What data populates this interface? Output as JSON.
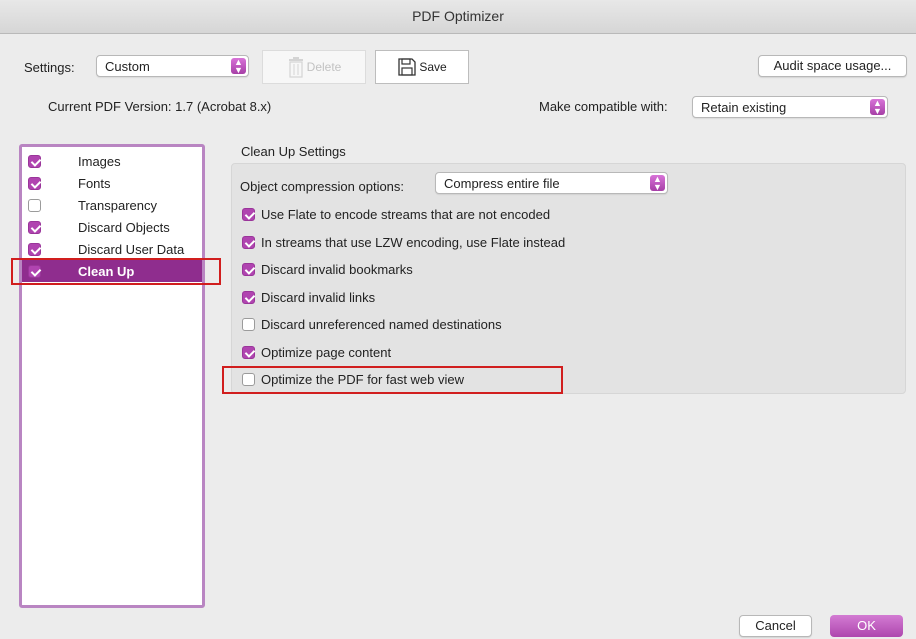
{
  "window": {
    "title": "PDF Optimizer"
  },
  "toolbar": {
    "settings_label": "Settings:",
    "settings_value": "Custom",
    "delete_label": "Delete",
    "save_label": "Save",
    "audit_label": "Audit space usage..."
  },
  "version": {
    "current_label": "Current PDF Version: 1.7 (Acrobat 8.x)",
    "compat_label": "Make compatible with:",
    "compat_value": "Retain existing"
  },
  "panels": [
    {
      "label": "Images",
      "checked": true
    },
    {
      "label": "Fonts",
      "checked": true
    },
    {
      "label": "Transparency",
      "checked": false
    },
    {
      "label": "Discard Objects",
      "checked": true
    },
    {
      "label": "Discard User Data",
      "checked": true
    },
    {
      "label": "Clean Up",
      "checked": true,
      "selected": true
    }
  ],
  "cleanup": {
    "heading": "Clean Up Settings",
    "compression_label": "Object compression options:",
    "compression_value": "Compress entire file",
    "options": [
      {
        "label": "Use Flate to encode streams that are not encoded",
        "checked": true
      },
      {
        "label": "In streams that use LZW encoding, use Flate instead",
        "checked": true
      },
      {
        "label": "Discard invalid bookmarks",
        "checked": true
      },
      {
        "label": "Discard invalid links",
        "checked": true
      },
      {
        "label": "Discard unreferenced named destinations",
        "checked": false
      },
      {
        "label": "Optimize page content",
        "checked": true
      },
      {
        "label": "Optimize the PDF for fast web view",
        "checked": false
      }
    ]
  },
  "footer": {
    "cancel_label": "Cancel",
    "ok_label": "OK"
  },
  "colors": {
    "accent": "#b044b0",
    "selection": "#8f2d8e",
    "highlight": "#d11e1e"
  }
}
